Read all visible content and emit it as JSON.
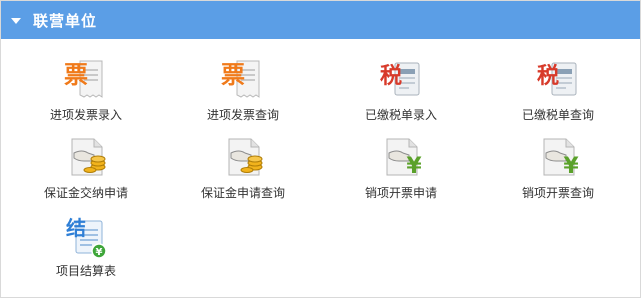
{
  "header": {
    "title": "联营单位"
  },
  "items": [
    {
      "label": "进项发票录入",
      "icon": "invoice-entry-icon",
      "glyph": "票"
    },
    {
      "label": "进项发票查询",
      "icon": "invoice-query-icon",
      "glyph": "票"
    },
    {
      "label": "已缴税单录入",
      "icon": "tax-entry-icon",
      "glyph": "税"
    },
    {
      "label": "已缴税单查询",
      "icon": "tax-query-icon",
      "glyph": "税"
    },
    {
      "label": "保证金交纳申请",
      "icon": "deposit-payment-icon"
    },
    {
      "label": "保证金申请查询",
      "icon": "deposit-query-icon"
    },
    {
      "label": "销项开票申请",
      "icon": "sales-invoice-apply-icon",
      "glyph": "¥"
    },
    {
      "label": "销项开票查询",
      "icon": "sales-invoice-query-icon",
      "glyph": "¥"
    },
    {
      "label": "项目结算表",
      "icon": "settlement-sheet-icon",
      "glyph": "结"
    }
  ],
  "colors": {
    "header_bg": "#5b9ee6",
    "invoice_glyph": "#f07a1a",
    "tax_glyph": "#d83a2a",
    "yen_glyph": "#5aa12a",
    "settle_glyph": "#2f7fd6",
    "coin": "#f2b31c"
  }
}
